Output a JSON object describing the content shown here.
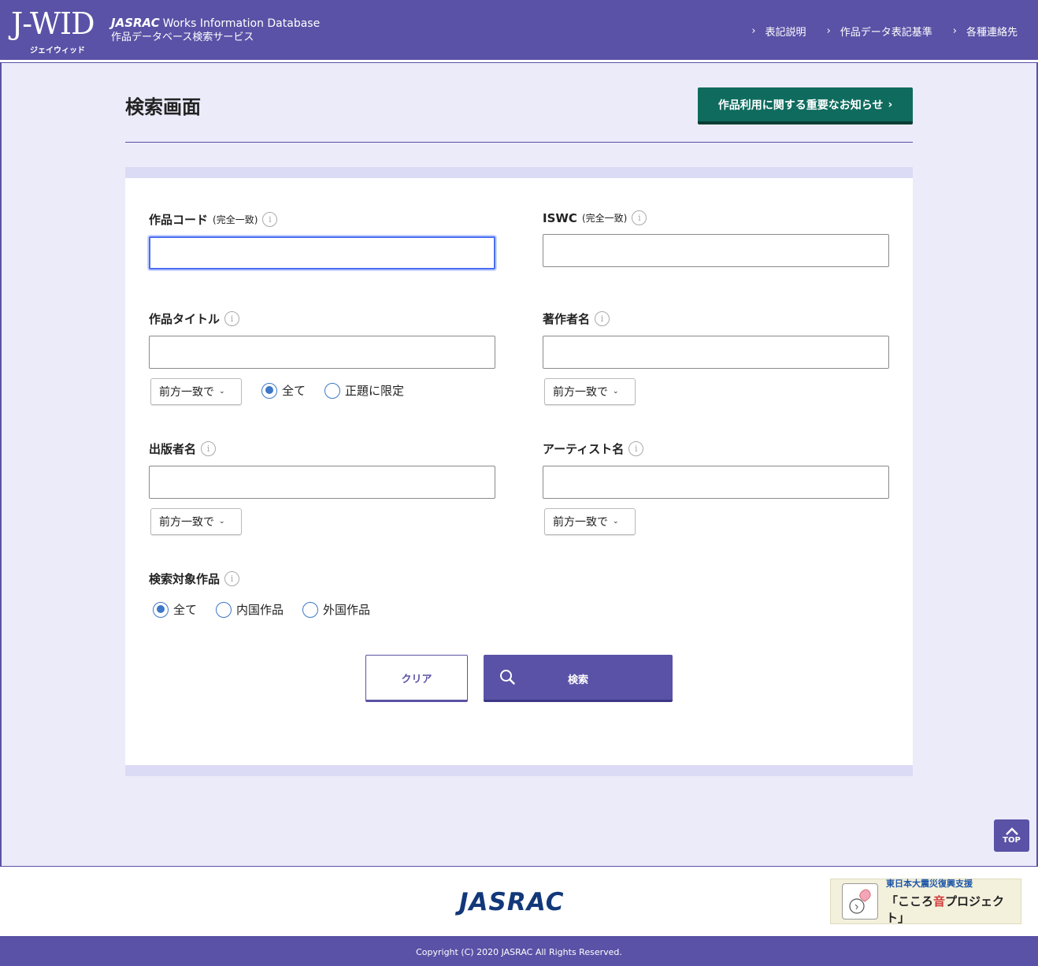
{
  "header": {
    "logo": "J-WID",
    "logo_sub": "ジェイウィッド",
    "brand": "JASRAC",
    "title_en": "Works Information Database",
    "title_jp": "作品データベース検索サービス",
    "nav": [
      "表記説明",
      "作品データ表記基準",
      "各種連絡先"
    ]
  },
  "main": {
    "page_title": "検索画面",
    "notice_button": "作品利用に関する重要なお知らせ",
    "fields": {
      "work_code": {
        "label": "作品コード",
        "note": "(完全一致)",
        "value": ""
      },
      "iswc": {
        "label": "ISWC",
        "note": "(完全一致)",
        "value": ""
      },
      "work_title": {
        "label": "作品タイトル",
        "value": "",
        "match": "前方一致で"
      },
      "author": {
        "label": "著作者名",
        "value": "",
        "match": "前方一致で"
      },
      "publisher": {
        "label": "出版者名",
        "value": "",
        "match": "前方一致で"
      },
      "artist": {
        "label": "アーティスト名",
        "value": "",
        "match": "前方一致で"
      },
      "target": {
        "label": "検索対象作品"
      }
    },
    "title_scope": {
      "options": [
        "全て",
        "正題に限定"
      ],
      "selected": "全て"
    },
    "target_scope": {
      "options": [
        "全て",
        "内国作品",
        "外国作品"
      ],
      "selected": "全て"
    },
    "clear_button": "クリア",
    "search_button": "検索",
    "top_button": "TOP"
  },
  "footer": {
    "logo": "JASRAC",
    "banner_line1": "東日本大震災復興支援",
    "banner_line2_pre": "「こころ",
    "banner_line2_hl": "音",
    "banner_line2_post": "プロジェクト」",
    "copyright": "Copyright (C) 2020 JASRAC All Rights Reserved."
  },
  "colors": {
    "primary": "#5a52a6",
    "notice": "#0f6b5e",
    "background": "#ecebfa",
    "focus": "#4a6cf0",
    "radio": "#3d77c8"
  }
}
